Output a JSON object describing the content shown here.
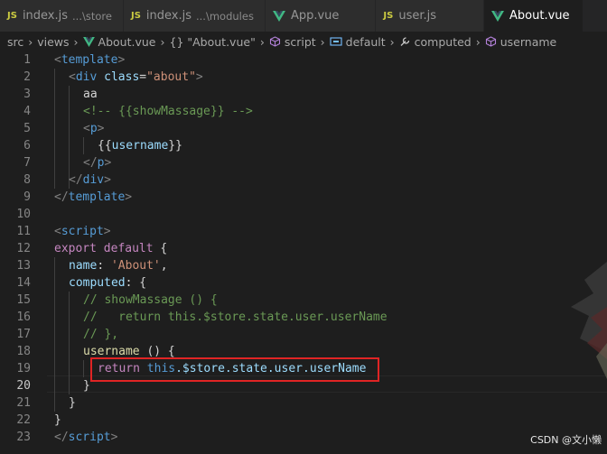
{
  "tabs": [
    {
      "label": "index.js",
      "desc": "...\\store",
      "icon": "js-icon",
      "active": false
    },
    {
      "label": "index.js",
      "desc": "...\\modules",
      "icon": "js-icon",
      "active": false
    },
    {
      "label": "App.vue",
      "desc": "",
      "icon": "vue-icon",
      "active": false
    },
    {
      "label": "user.js",
      "desc": "",
      "icon": "js-icon",
      "active": false
    },
    {
      "label": "About.vue",
      "desc": "",
      "icon": "vue-icon",
      "active": true
    }
  ],
  "js_icon_text": "JS",
  "breadcrumb": {
    "src": "src",
    "views": "views",
    "file": "About.vue",
    "component": "{} \"About.vue\"",
    "script": "script",
    "default": "default",
    "computed": "computed",
    "username": "username"
  },
  "code": {
    "l1_open": "<",
    "l1_tag": "template",
    "l1_close": ">",
    "l2_open": "<",
    "l2_tag": "div",
    "l2_attr": "class",
    "l2_eq": "=",
    "l2_val": "\"about\"",
    "l2_close": ">",
    "l3": "aa",
    "l4": "<!-- {{showMassage}} -->",
    "l5_open": "<",
    "l5_tag": "p",
    "l5_close": ">",
    "l6_a": "{{",
    "l6_b": "username",
    "l6_c": "}}",
    "l7_open": "</",
    "l7_tag": "p",
    "l7_close": ">",
    "l8_open": "</",
    "l8_tag": "div",
    "l8_close": ">",
    "l9_open": "</",
    "l9_tag": "template",
    "l9_close": ">",
    "l11_open": "<",
    "l11_tag": "script",
    "l11_close": ">",
    "l12_kw1": "export",
    "l12_kw2": "default",
    "l12_rest": "{",
    "l13_key": "name",
    "l13_colon": ": ",
    "l13_val": "'About'",
    "l13_comma": ",",
    "l14_key": "computed",
    "l14_rest": ": {",
    "l15": "// showMassage () {",
    "l16": "//   return this.$store.state.user.userName",
    "l17": "// },",
    "l18_fn": "username",
    "l18_rest": " () {",
    "l19_kw": "return",
    "l19_this": "this",
    "l19_rest": ".$store.state.user.userName",
    "l20": "}",
    "l21": "}",
    "l22": "}",
    "l23_open": "</",
    "l23_tag": "script",
    "l23_close": ">"
  },
  "line_numbers": [
    "1",
    "2",
    "3",
    "4",
    "5",
    "6",
    "7",
    "8",
    "9",
    "10",
    "11",
    "12",
    "13",
    "14",
    "15",
    "16",
    "17",
    "18",
    "19",
    "20",
    "21",
    "22",
    "23"
  ],
  "current_line": "20",
  "watermark": "CSDN @文小懒",
  "colors": {
    "editor_bg": "#1e1e1e",
    "tab_bar_bg": "#252526",
    "js_icon": "#cbcb41",
    "vue_icon": "#41b883",
    "annotation_box": "#e02424"
  }
}
